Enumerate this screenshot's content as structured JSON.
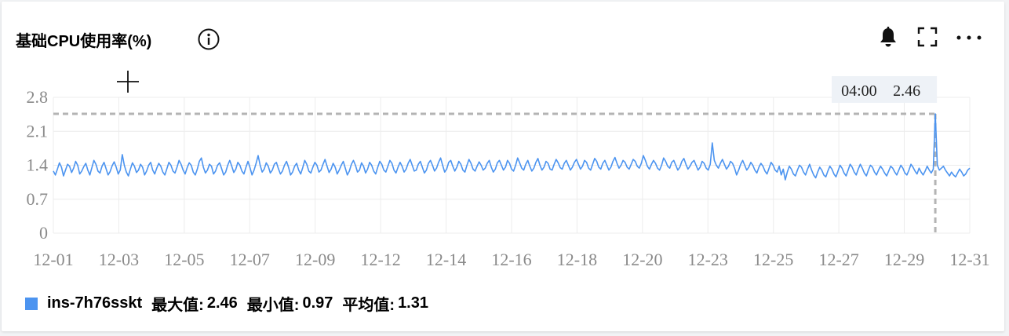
{
  "title": "基础CPU使用率(%)",
  "icons": [
    "info-icon",
    "bell-icon",
    "fullscreen-icon",
    "more-icon",
    "crosshair-icon"
  ],
  "colors": {
    "series": "#4c94f0",
    "grid": "#ececec",
    "reference": "#b4b4b4",
    "axis_text": "#8a8a8a"
  },
  "tooltip": {
    "time": "04:00",
    "value": "2.46"
  },
  "legend": {
    "series_name": "ins-7h76sskt",
    "max_label": "最大值:",
    "max_value": "2.46",
    "min_label": "最小值:",
    "min_value": "0.97",
    "avg_label": "平均值:",
    "avg_value": "1.31"
  },
  "chart_data": {
    "type": "line",
    "title": "基础CPU使用率(%)",
    "xlabel": "",
    "ylabel": "",
    "y_ticks": [
      "2.8",
      "2.1",
      "1.4",
      "0.7",
      "0"
    ],
    "ylim": [
      0,
      2.8
    ],
    "x_ticks": [
      "12-01",
      "12-03",
      "12-05",
      "12-07",
      "12-09",
      "12-12",
      "12-14",
      "12-16",
      "12-18",
      "12-20",
      "12-23",
      "12-25",
      "12-27",
      "12-29",
      "12-31"
    ],
    "grid": true,
    "legend_position": "bottom-left",
    "max_reference": 2.46,
    "highlight": {
      "x": "12-30 04:00",
      "y": 2.46
    },
    "series": [
      {
        "name": "ins-7h76sskt",
        "values": [
          1.28,
          1.2,
          1.32,
          1.45,
          1.36,
          1.18,
          1.3,
          1.42,
          1.38,
          1.25,
          1.34,
          1.48,
          1.4,
          1.22,
          1.28,
          1.37,
          1.44,
          1.3,
          1.2,
          1.35,
          1.5,
          1.42,
          1.28,
          1.24,
          1.38,
          1.46,
          1.33,
          1.2,
          1.27,
          1.39,
          1.47,
          1.36,
          1.22,
          1.3,
          1.62,
          1.4,
          1.26,
          1.18,
          1.32,
          1.45,
          1.38,
          1.25,
          1.3,
          1.42,
          1.36,
          1.2,
          1.28,
          1.4,
          1.46,
          1.3,
          1.22,
          1.34,
          1.44,
          1.38,
          1.26,
          1.2,
          1.33,
          1.46,
          1.4,
          1.28,
          1.24,
          1.36,
          1.5,
          1.42,
          1.3,
          1.22,
          1.35,
          1.45,
          1.4,
          1.26,
          1.2,
          1.32,
          1.48,
          1.55,
          1.36,
          1.24,
          1.3,
          1.42,
          1.38,
          1.22,
          1.28,
          1.4,
          1.45,
          1.33,
          1.2,
          1.26,
          1.4,
          1.5,
          1.38,
          1.25,
          1.32,
          1.46,
          1.4,
          1.28,
          1.22,
          1.36,
          1.48,
          1.35,
          1.2,
          1.3,
          1.44,
          1.6,
          1.4,
          1.26,
          1.32,
          1.45,
          1.38,
          1.24,
          1.3,
          1.42,
          1.46,
          1.33,
          1.22,
          1.28,
          1.4,
          1.48,
          1.36,
          1.2,
          1.26,
          1.38,
          1.44,
          1.3,
          1.22,
          1.35,
          1.5,
          1.42,
          1.28,
          1.24,
          1.36,
          1.46,
          1.4,
          1.26,
          1.3,
          1.42,
          1.52,
          1.38,
          1.25,
          1.32,
          1.44,
          1.36,
          1.22,
          1.3,
          1.4,
          1.48,
          1.34,
          1.2,
          1.28,
          1.42,
          1.5,
          1.4,
          1.26,
          1.3,
          1.45,
          1.38,
          1.24,
          1.32,
          1.46,
          1.4,
          1.28,
          1.22,
          1.36,
          1.48,
          1.42,
          1.3,
          1.26,
          1.38,
          1.5,
          1.44,
          1.3,
          1.24,
          1.36,
          1.46,
          1.38,
          1.26,
          1.32,
          1.44,
          1.52,
          1.4,
          1.28,
          1.3,
          1.42,
          1.48,
          1.36,
          1.24,
          1.3,
          1.44,
          1.5,
          1.4,
          1.28,
          1.34,
          1.46,
          1.55,
          1.4,
          1.26,
          1.32,
          1.46,
          1.5,
          1.38,
          1.28,
          1.36,
          1.48,
          1.42,
          1.3,
          1.26,
          1.4,
          1.52,
          1.44,
          1.32,
          1.28,
          1.38,
          1.47,
          1.4,
          1.3,
          1.34,
          1.44,
          1.5,
          1.36,
          1.26,
          1.32,
          1.45,
          1.5,
          1.4,
          1.3,
          1.36,
          1.5,
          1.44,
          1.32,
          1.28,
          1.4,
          1.55,
          1.45,
          1.34,
          1.3,
          1.42,
          1.5,
          1.38,
          1.28,
          1.34,
          1.46,
          1.54,
          1.4,
          1.3,
          1.36,
          1.48,
          1.44,
          1.32,
          1.3,
          1.42,
          1.52,
          1.45,
          1.35,
          1.32,
          1.44,
          1.5,
          1.4,
          1.3,
          1.36,
          1.46,
          1.52,
          1.42,
          1.32,
          1.38,
          1.5,
          1.46,
          1.34,
          1.3,
          1.42,
          1.54,
          1.48,
          1.36,
          1.32,
          1.44,
          1.5,
          1.4,
          1.3,
          1.36,
          1.48,
          1.56,
          1.44,
          1.34,
          1.4,
          1.5,
          1.46,
          1.36,
          1.32,
          1.42,
          1.52,
          1.48,
          1.38,
          1.34,
          1.44,
          1.6,
          1.5,
          1.38,
          1.32,
          1.42,
          1.5,
          1.44,
          1.34,
          1.3,
          1.4,
          1.55,
          1.48,
          1.38,
          1.34,
          1.46,
          1.5,
          1.4,
          1.3,
          1.36,
          1.48,
          1.54,
          1.42,
          1.32,
          1.38,
          1.46,
          1.5,
          1.4,
          1.3,
          1.36,
          1.48,
          1.44,
          1.34,
          1.3,
          1.42,
          1.86,
          1.5,
          1.4,
          1.34,
          1.44,
          1.52,
          1.42,
          1.32,
          1.38,
          1.48,
          1.44,
          1.34,
          1.2,
          1.3,
          1.42,
          1.5,
          1.4,
          1.3,
          1.36,
          1.46,
          1.4,
          1.3,
          1.24,
          1.36,
          1.44,
          1.38,
          1.28,
          1.22,
          1.34,
          1.46,
          1.4,
          1.3,
          1.26,
          1.38,
          1.2,
          1.32,
          1.1,
          1.26,
          1.38,
          1.32,
          1.22,
          1.18,
          1.3,
          1.4,
          1.36,
          1.26,
          1.2,
          1.32,
          1.42,
          1.3,
          1.2,
          1.14,
          1.26,
          1.36,
          1.3,
          1.2,
          1.16,
          1.28,
          1.38,
          1.32,
          1.22,
          1.16,
          1.28,
          1.4,
          1.34,
          1.24,
          1.18,
          1.3,
          1.42,
          1.36,
          1.26,
          1.2,
          1.32,
          1.42,
          1.34,
          1.24,
          1.18,
          1.3,
          1.4,
          1.36,
          1.26,
          1.2,
          1.3,
          1.38,
          1.32,
          1.24,
          1.18,
          1.28,
          1.38,
          1.34,
          1.26,
          1.2,
          1.3,
          1.4,
          1.34,
          1.24,
          1.2,
          1.3,
          1.42,
          1.36,
          1.28,
          1.22,
          1.34,
          1.26,
          1.2,
          1.28,
          1.38,
          1.3,
          1.24,
          1.32,
          2.46,
          1.4,
          1.3,
          1.34,
          1.38,
          1.3,
          1.24,
          1.18,
          1.26,
          1.2,
          1.16,
          1.24,
          1.32,
          1.26,
          1.18,
          1.22,
          1.3,
          1.34
        ]
      }
    ]
  }
}
